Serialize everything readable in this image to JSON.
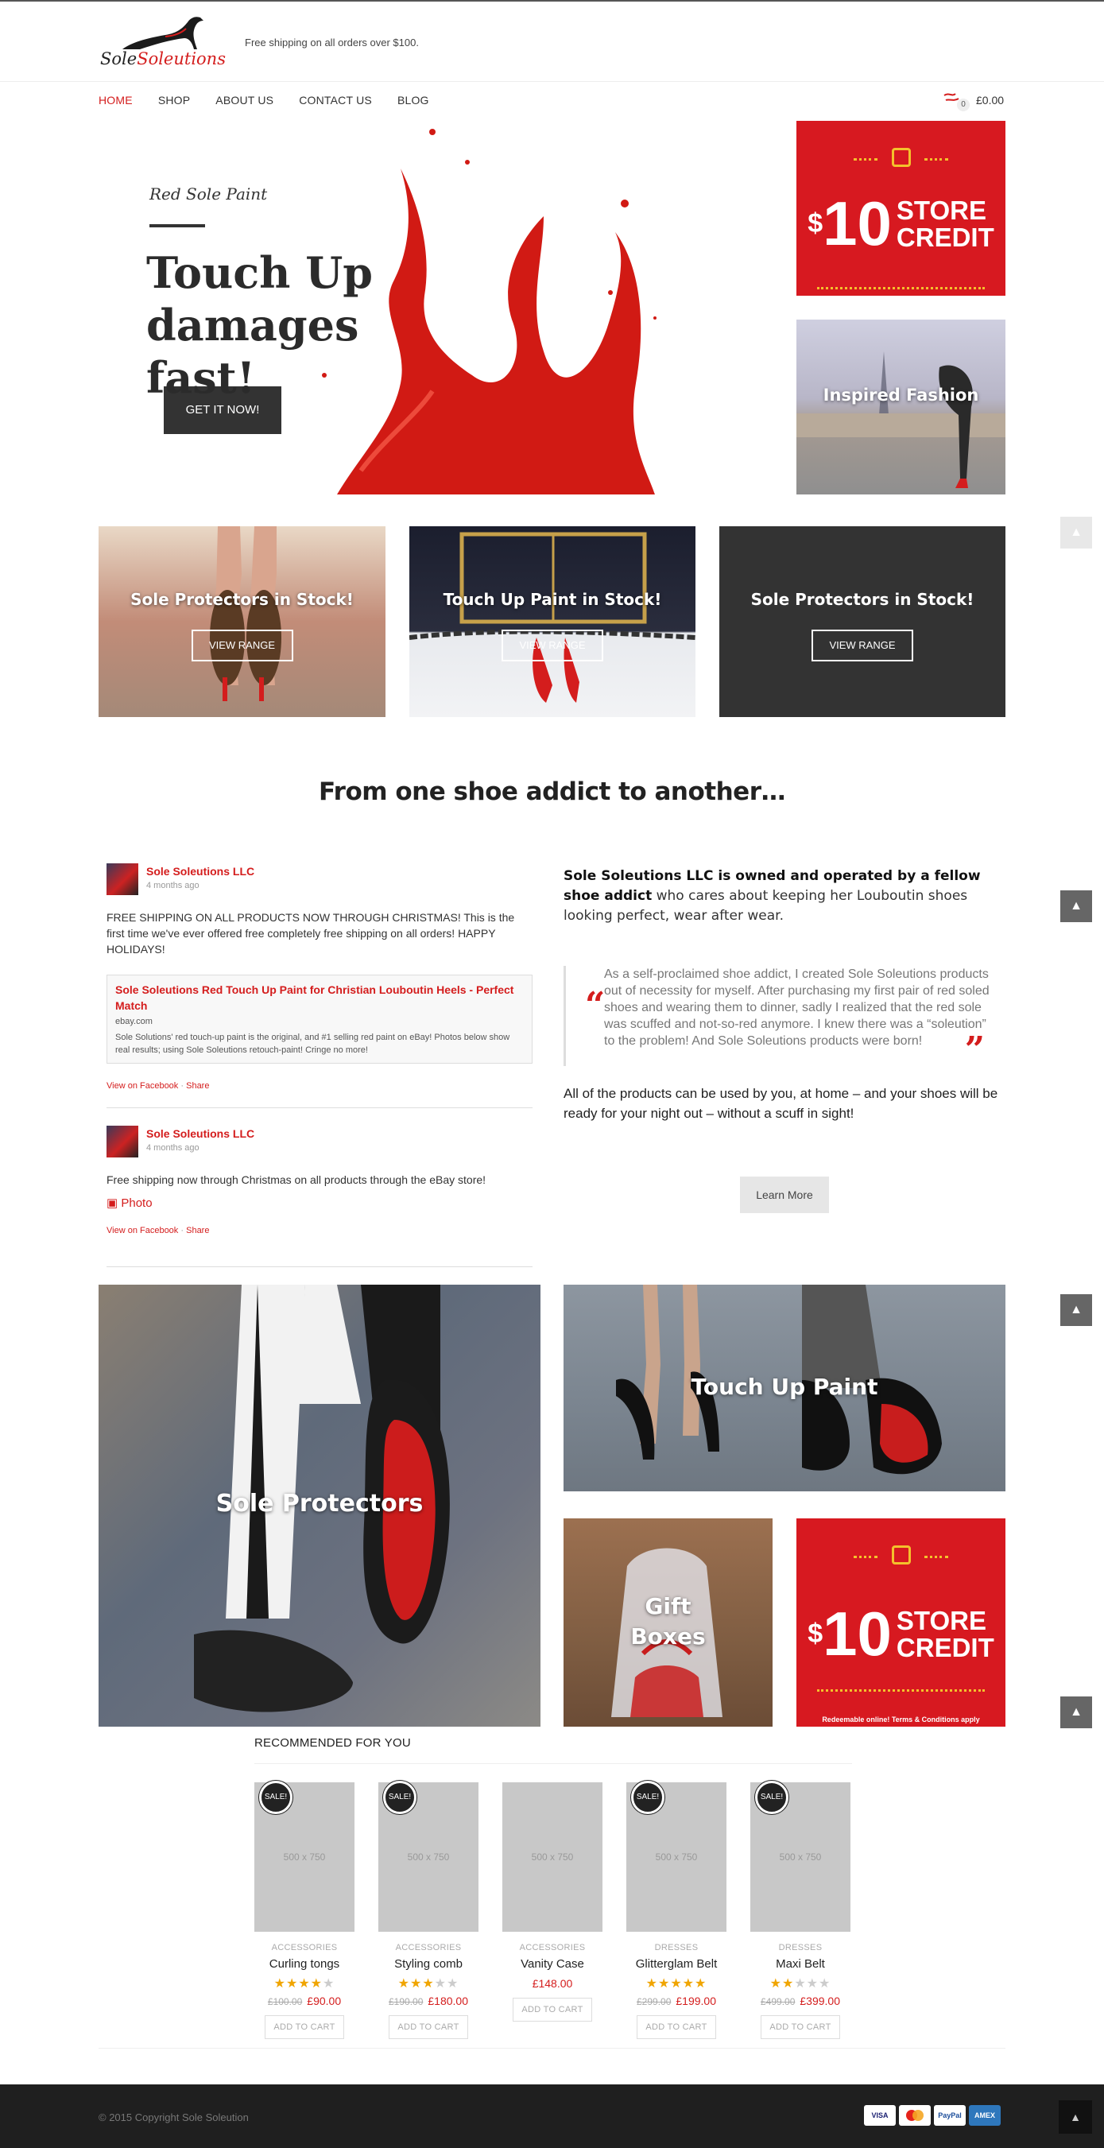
{
  "header": {
    "logo_text_1": "Sole",
    "logo_text_2": "Soleutions",
    "shipping_note": "Free shipping on all orders over $100.",
    "cart_count": "0",
    "cart_total": "£0.00"
  },
  "nav": {
    "items": [
      {
        "label": "HOME",
        "active": true
      },
      {
        "label": "SHOP"
      },
      {
        "label": "ABOUT US"
      },
      {
        "label": "CONTACT US"
      },
      {
        "label": "BLOG"
      }
    ]
  },
  "hero": {
    "subtitle": "Red Sole Paint",
    "title": "Touch Up damages fast!",
    "button": "GET IT NOW!"
  },
  "promo": {
    "currency": "$",
    "amount": "10",
    "line1": "STORE",
    "line2": "CREDIT",
    "fine_print": "Redeemable online! Terms & Conditions apply"
  },
  "inspired": {
    "label": "Inspired Fashion"
  },
  "feature_tiles": [
    {
      "title": "Sole Protectors in Stock!",
      "button": "VIEW RANGE"
    },
    {
      "title": "Touch Up Paint in Stock!",
      "button": "VIEW RANGE"
    },
    {
      "title": "Sole Protectors in Stock!",
      "button": "VIEW RANGE"
    }
  ],
  "section_heading": "From one shoe addict to another…",
  "facebook": {
    "posts": [
      {
        "author": "Sole Soleutions LLC",
        "time": "4 months ago",
        "text": "FREE SHIPPING ON ALL PRODUCTS NOW THROUGH CHRISTMAS! This is the first time we've ever offered free completely free shipping on all orders! HAPPY HOLIDAYS!",
        "link_title": "Sole Soleutions Red Touch Up Paint for Christian Louboutin Heels - Perfect Match",
        "link_domain": "ebay.com",
        "link_excerpt": "Sole Solutions' red touch-up paint is the original, and #1 selling red paint on eBay! Photos below show real results; using Sole Soleutions retouch-paint! Cringe no more!",
        "view": "View on Facebook",
        "share": "Share"
      },
      {
        "author": "Sole Soleutions LLC",
        "time": "4 months ago",
        "text": "Free shipping now through Christmas on all products through the eBay store!",
        "photo": "Photo",
        "view": "View on Facebook",
        "share": "Share"
      }
    ]
  },
  "about": {
    "lead_bold": "Sole Soleutions LLC is owned and operated by a fellow shoe addict",
    "lead_rest": "who cares about keeping her Louboutin shoes looking perfect, wear after wear.",
    "quote": "As a self-proclaimed shoe addict, I created Sole Soleutions products out of necessity for myself. After purchasing my first pair of red soled shoes and wearing them to dinner, sadly I realized that the red sole was scuffed and not-so-red anymore. I knew there was a “soleution” to the problem! And Sole Soleutions products were born!",
    "closing": "All of the products can be used by you, at home – and your shoes will be ready for your night out – without a scuff in sight!",
    "button": "Learn More"
  },
  "grid_tiles": {
    "sole_protectors": "Sole Protectors",
    "touch_up_paint": "Touch Up Paint",
    "gift_boxes": "Gift Boxes"
  },
  "recommended": {
    "heading": "RECOMMENDED FOR YOU",
    "placeholder": "500 x 750",
    "sale_label": "SALE!",
    "add_label": "ADD TO CART",
    "products": [
      {
        "category": "ACCESSORIES",
        "name": "Curling tongs",
        "rating": 4,
        "old_price": "£100.00",
        "price": "£90.00",
        "sale": true
      },
      {
        "category": "ACCESSORIES",
        "name": "Styling comb",
        "rating": 3,
        "old_price": "£190.00",
        "price": "£180.00",
        "sale": true
      },
      {
        "category": "ACCESSORIES",
        "name": "Vanity Case",
        "rating": 0,
        "old_price": "",
        "price": "£148.00",
        "sale": false
      },
      {
        "category": "DRESSES",
        "name": "Glitterglam Belt",
        "rating": 5,
        "old_price": "£299.00",
        "price": "£199.00",
        "sale": true
      },
      {
        "category": "DRESSES",
        "name": "Maxi Belt",
        "rating": 2,
        "old_price": "£499.00",
        "price": "£399.00",
        "sale": true
      }
    ]
  },
  "footer": {
    "copyright": "© 2015 Copyright Sole Soleution",
    "payments": [
      "VISA",
      "MC",
      "PayPal",
      "AMEX"
    ]
  },
  "colors": {
    "accent": "#d41d1d",
    "promo_red": "#d71920",
    "promo_yellow": "#f4c12c",
    "dark": "#333333"
  }
}
